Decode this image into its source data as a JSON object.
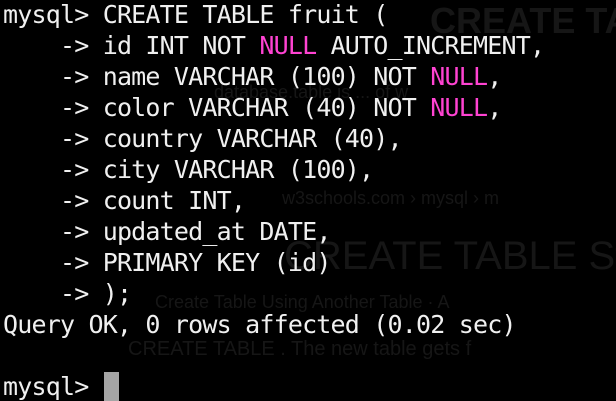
{
  "colors": {
    "background": "#000000",
    "text": "#f0f0f0",
    "null_keyword": "#ff43d2",
    "cursor": "#a5a5a5"
  },
  "terminal": {
    "prompt": "mysql> ",
    "continuation": "    -> ",
    "statement": [
      "CREATE TABLE fruit (",
      "id INT NOT ",
      "NULL",
      " AUTO_INCREMENT,",
      "name VARCHAR (100) NOT ",
      "NULL",
      ",",
      "color VARCHAR (40) NOT ",
      "NULL",
      ",",
      "country VARCHAR (40),",
      "city VARCHAR (100),",
      "count INT,",
      "updated_at DATE,",
      "PRIMARY KEY (id)",
      ");"
    ],
    "result": "Query OK, 0 rows affected (0.02 sec)",
    "blank": "",
    "cursor_visible": true
  },
  "background_ghost_text": [
    "CREATE TABLE",
    "database.table is ... of w",
    "w3schools.com › mysql › m",
    "CREATE TABLE St",
    "Create Table Using Another Table · A",
    "CREATE TABLE . The new table gets f"
  ]
}
